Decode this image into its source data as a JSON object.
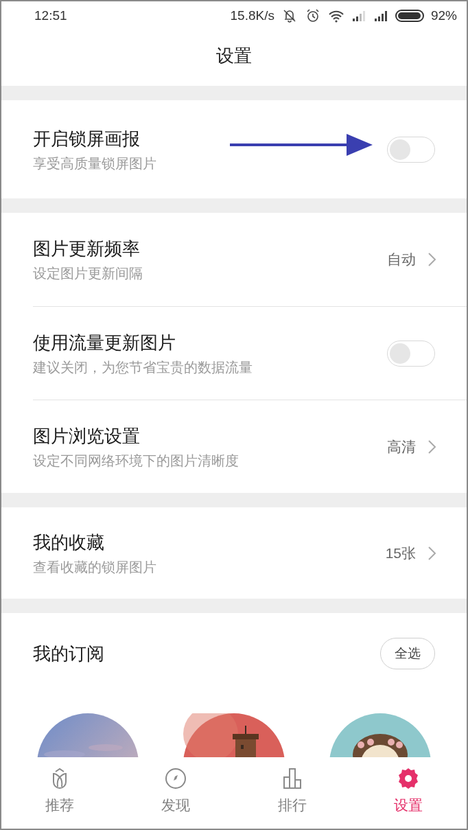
{
  "status_bar": {
    "time": "12:51",
    "net_speed": "15.8K/s",
    "battery": "92%"
  },
  "title": "设置",
  "sections": [
    [
      {
        "kind": "toggle",
        "title": "开启锁屏画报",
        "subtitle": "享受高质量锁屏图片",
        "on": false
      }
    ],
    [
      {
        "kind": "link",
        "title": "图片更新频率",
        "subtitle": "设定图片更新间隔",
        "value": "自动"
      },
      {
        "kind": "toggle",
        "title": "使用流量更新图片",
        "subtitle": "建议关闭，为您节省宝贵的数据流量",
        "on": false
      },
      {
        "kind": "link",
        "title": "图片浏览设置",
        "subtitle": "设定不同网络环境下的图片清晰度",
        "value": "高清"
      }
    ],
    [
      {
        "kind": "link",
        "title": "我的收藏",
        "subtitle": "查看收藏的锁屏图片",
        "value": "15张"
      }
    ]
  ],
  "subscriptions": {
    "title": "我的订阅",
    "select_all": "全选"
  },
  "nav": [
    {
      "label": "推荐",
      "selected": false
    },
    {
      "label": "发现",
      "selected": false
    },
    {
      "label": "排行",
      "selected": false
    },
    {
      "label": "设置",
      "selected": true
    }
  ]
}
